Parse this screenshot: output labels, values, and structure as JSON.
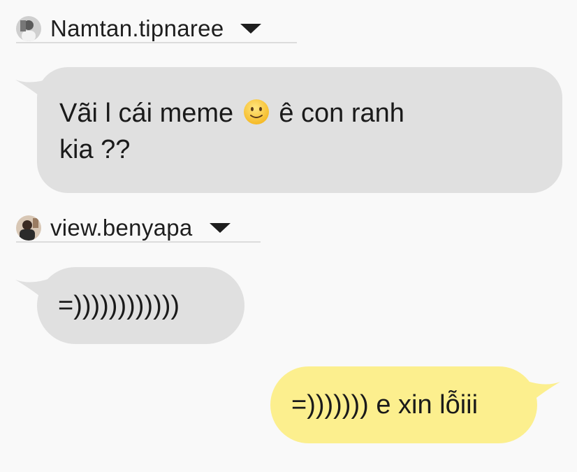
{
  "messages": [
    {
      "sender": "Namtan.tipnaree",
      "line1_before": "Vãi l cái meme",
      "line1_emoji": "slightly-smiling-face-emoji",
      "line1_after": "ê con ranh",
      "line2": "kia ??"
    },
    {
      "sender": "view.benyapa",
      "text": "=))))))))))))"
    },
    {
      "sender": "",
      "text": "=))))))) e xin lỗiii"
    }
  ],
  "colors": {
    "background": "#f9f9f9",
    "incoming_bubble": "#e0e0e0",
    "outgoing_bubble": "#fcef8e",
    "text": "#1a1a1a"
  }
}
